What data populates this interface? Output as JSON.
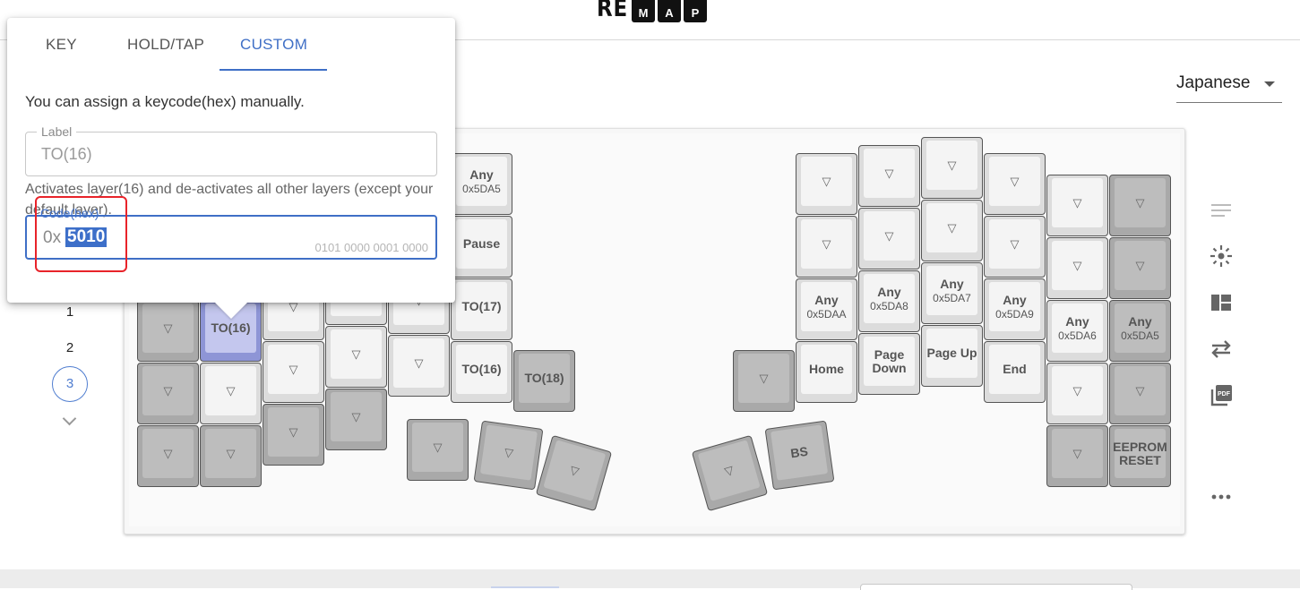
{
  "header": {
    "logo_left": "RE",
    "logo_letters": [
      "M",
      "A",
      "P"
    ]
  },
  "language_select": {
    "value": "Japanese"
  },
  "layers": {
    "items": [
      "1",
      "2",
      "3"
    ],
    "active": "3"
  },
  "popup": {
    "tabs": [
      "KEY",
      "HOLD/TAP",
      "CUSTOM"
    ],
    "active_tab": "CUSTOM",
    "description": "You can assign a keycode(hex) manually.",
    "label_field": {
      "legend": "Label",
      "value": "TO(16)"
    },
    "help_text": "Activates layer(16) and de-activates all other layers (except your default layer).",
    "code_field": {
      "legend": "Code(hex)",
      "prefix": "0x",
      "value": "5010",
      "binary": "0101 0000 0001 0000"
    }
  },
  "sidebar_icons": [
    "lines-icon",
    "light-icon",
    "layout-icon",
    "swap-icon",
    "pdf-icon",
    "more-icon"
  ],
  "keyboard": {
    "triangle": "▽",
    "keys": [
      {
        "k": "any_5da5_left",
        "label": "Any",
        "sub": "0x5DA5"
      },
      {
        "k": "pause",
        "label": "Pause",
        "sub": ""
      },
      {
        "k": "to17",
        "label": "TO(17)",
        "sub": ""
      },
      {
        "k": "to16_a",
        "label": "TO(16)",
        "sub": ""
      },
      {
        "k": "to16_b",
        "label": "TO(16)",
        "sub": ""
      },
      {
        "k": "to18",
        "label": "TO(18)",
        "sub": ""
      },
      {
        "k": "any_5daa",
        "label": "Any",
        "sub": "0x5DAA"
      },
      {
        "k": "any_5da8",
        "label": "Any",
        "sub": "0x5DA8"
      },
      {
        "k": "any_5da7",
        "label": "Any",
        "sub": "0x5DA7"
      },
      {
        "k": "any_5da9",
        "label": "Any",
        "sub": "0x5DA9"
      },
      {
        "k": "any_5da6",
        "label": "Any",
        "sub": "0x5DA6"
      },
      {
        "k": "any_5da5_right",
        "label": "Any",
        "sub": "0x5DA5"
      },
      {
        "k": "home",
        "label": "Home",
        "sub": ""
      },
      {
        "k": "page_down",
        "label": "Page Down",
        "sub": ""
      },
      {
        "k": "page_up",
        "label": "Page Up",
        "sub": ""
      },
      {
        "k": "end",
        "label": "End",
        "sub": ""
      },
      {
        "k": "eeprom_reset",
        "label": "EEPROM RESET",
        "sub": ""
      },
      {
        "k": "bs",
        "label": "BS",
        "sub": ""
      }
    ]
  }
}
